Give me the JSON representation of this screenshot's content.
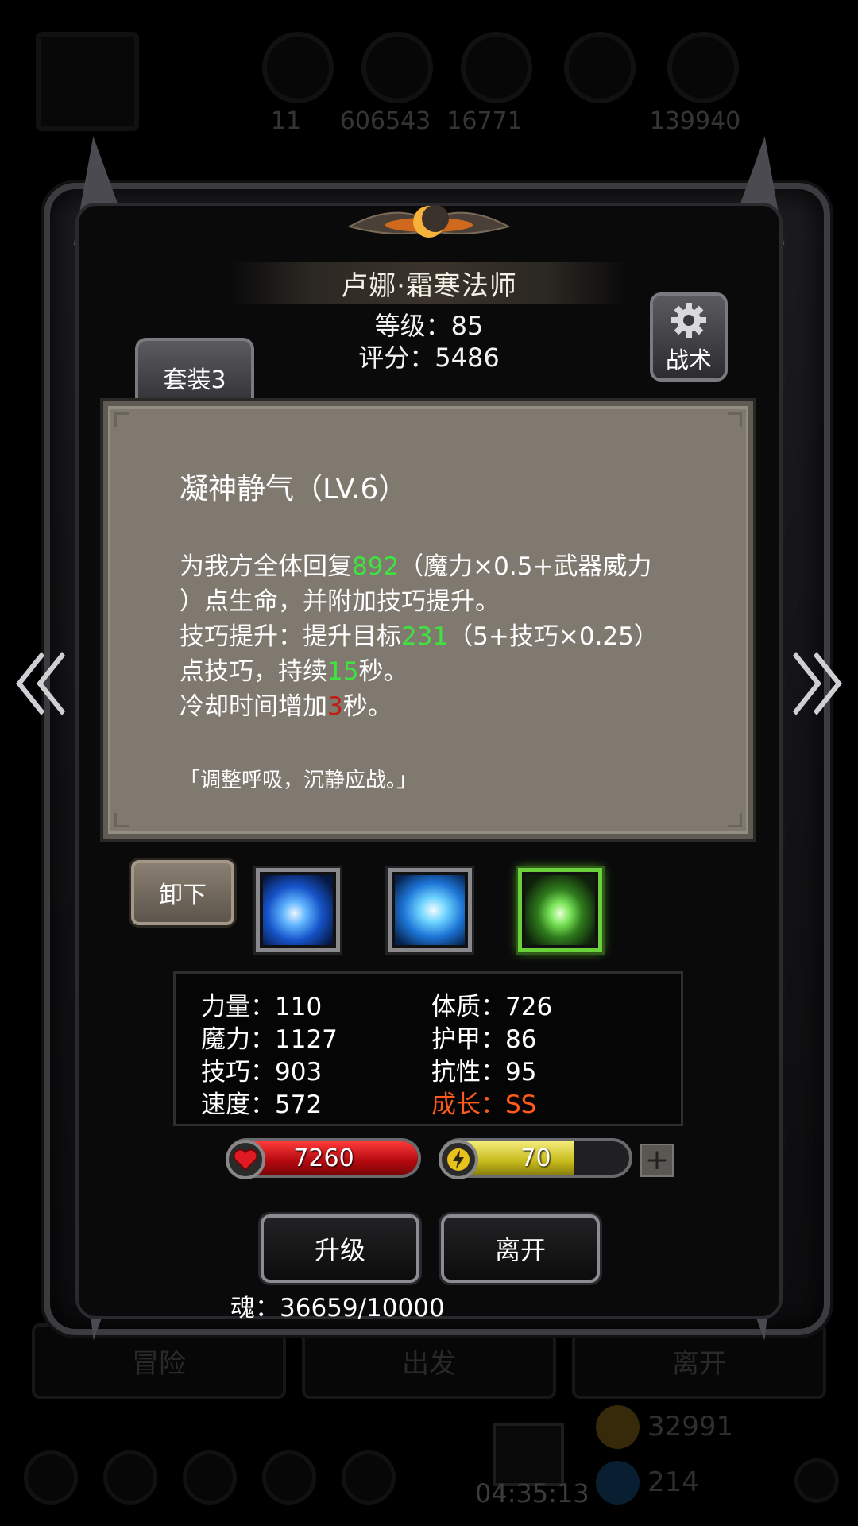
{
  "background": {
    "resources": [
      "11",
      "606543",
      "16771",
      "",
      "139940"
    ],
    "buttons": [
      "冒险",
      "出发",
      "离开"
    ],
    "coins": "32991",
    "gems": "214",
    "timer": "04:35:13"
  },
  "hero": {
    "name": "卢娜·霜寒法师",
    "level": "等级：85",
    "score": "评分：5486"
  },
  "buttons": {
    "suit": "套装3",
    "tactics": "战术",
    "unequip": "卸下",
    "upgrade": "升级",
    "leave": "离开"
  },
  "tooltip": {
    "title": "凝神静气（LV.6）",
    "line1_a": "为我方全体回复",
    "line1_b": "892",
    "line1_c": "（魔力×0.5+武器威力",
    "line2": "）点生命，并附加技巧提升。",
    "line3_a": "技巧提升：提升目标",
    "line3_b": "231",
    "line3_c": "（5+技巧×0.25）",
    "line4_a": "点技巧，持续",
    "line4_b": "15",
    "line4_c": "秒。",
    "line5_a": "冷却时间增加",
    "line5_b": "3",
    "line5_c": "秒。",
    "quote": "「调整呼吸，沉静应战。」"
  },
  "skills": [
    {
      "name": "ice-bolt-icon",
      "selected": false
    },
    {
      "name": "frost-storm-icon",
      "selected": false
    },
    {
      "name": "green-heal-icon",
      "selected": true
    }
  ],
  "stats": {
    "str": "力量：110",
    "con": "体质：726",
    "mag": "魔力：1127",
    "arm": "护甲：86",
    "skl": "技巧：903",
    "res": "抗性：95",
    "spd": "速度：572",
    "grw": "成长：SS"
  },
  "bars": {
    "hp": "7260",
    "hp_fill": 1.0,
    "energy": "70",
    "energy_fill": 0.7
  },
  "soul": "魂：36659/10000",
  "colors": {
    "highlight_green": "#3fe23f",
    "highlight_red": "#c21d12",
    "growth_orange": "#ff5a1c",
    "hp_red": "#d0141a",
    "energy_yellow": "#e3d63a"
  }
}
